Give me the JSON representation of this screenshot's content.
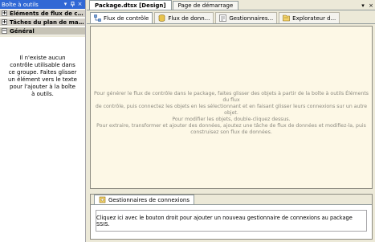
{
  "toolbox": {
    "title": "Boîte à outils",
    "controls": {
      "dropdown": "▾",
      "pin": "ᵱ",
      "close": "×"
    },
    "sections": [
      {
        "label": "Éléments de flux de co...",
        "state": "+"
      },
      {
        "label": "Tâches du plan de mai...",
        "state": "+"
      },
      {
        "label": "Général",
        "state": "−"
      }
    ],
    "empty_message": "Il n'existe aucun contrôle utilisable dans ce groupe. Faites glisser un élément vers le texte pour l'ajouter à la boîte à outils."
  },
  "document": {
    "tabs": [
      {
        "label": "Package.dtsx [Design]",
        "active": true
      },
      {
        "label": "Page de démarrage",
        "active": false
      }
    ],
    "controls": {
      "dropdown": "▾",
      "close": "×"
    }
  },
  "designer_tabs": [
    {
      "label": "Flux de contrôle",
      "icon": "control-flow-icon",
      "active": true
    },
    {
      "label": "Flux de donn...",
      "icon": "data-flow-icon",
      "active": false
    },
    {
      "label": "Gestionnaires...",
      "icon": "event-handlers-icon",
      "active": false
    },
    {
      "label": "Explorateur d...",
      "icon": "package-explorer-icon",
      "active": false
    }
  ],
  "canvas": {
    "hint_lines": [
      "Pour générer le flux de contrôle dans le package, faites glisser des objets à partir de la boîte à outils Éléments du flux",
      "de contrôle, puis connectez les objets en les sélectionnant et en faisant glisser leurs connexions sur un autre objet.",
      "Pour modifier les objets, double-cliquez dessus.",
      "Pour extraire, transformer et ajouter des données, ajoutez une tâche de flux de données et modifiez-la, puis",
      "construisez son flux de données."
    ]
  },
  "connection_managers": {
    "tab_label": "Gestionnaires de connexions",
    "message": "Cliquez ici avec le bouton droit pour ajouter un nouveau gestionnaire de connexions au package SSIS."
  }
}
